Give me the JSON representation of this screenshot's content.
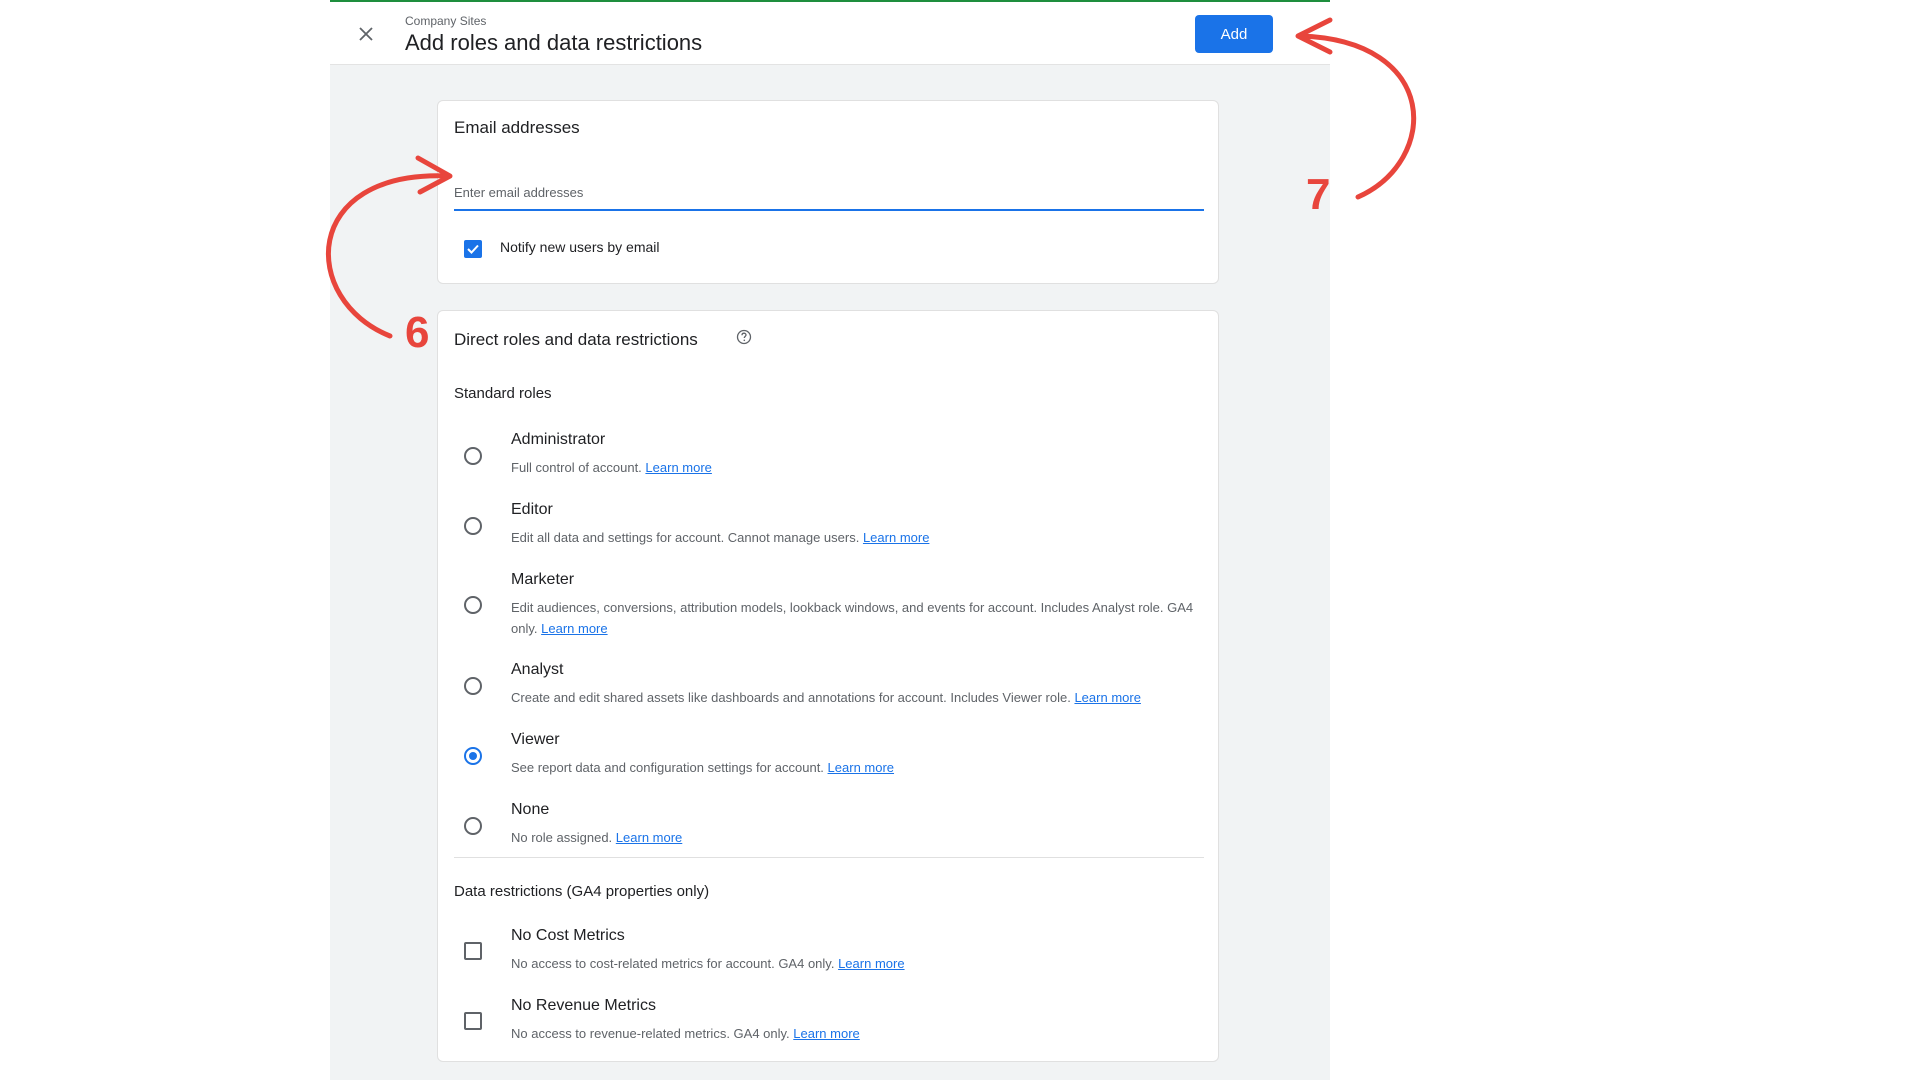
{
  "header": {
    "breadcrumb": "Company Sites",
    "title": "Add roles and data restrictions",
    "add_label": "Add"
  },
  "email_card": {
    "title": "Email addresses",
    "placeholder": "Enter email addresses",
    "value": "",
    "notify_label": "Notify new users by email",
    "notify_checked": true
  },
  "roles_card": {
    "title": "Direct roles and data restrictions",
    "standard_label": "Standard roles",
    "roles": [
      {
        "name": "Administrator",
        "desc": "Full control of account.",
        "link": "Learn more"
      },
      {
        "name": "Editor",
        "desc": "Edit all data and settings for account. Cannot manage users.",
        "link": "Learn more"
      },
      {
        "name": "Marketer",
        "desc": "Edit audiences, conversions, attribution models, lookback windows, and events for account. Includes Analyst role. GA4 only.",
        "link": "Learn more"
      },
      {
        "name": "Analyst",
        "desc": "Create and edit shared assets like dashboards and annotations for account. Includes Viewer role.",
        "link": "Learn more"
      },
      {
        "name": "Viewer",
        "desc": "See report data and configuration settings for account.",
        "link": "Learn more"
      },
      {
        "name": "None",
        "desc": "No role assigned.",
        "link": "Learn more"
      }
    ],
    "selected_role": "Viewer",
    "restrictions_label": "Data restrictions (GA4 properties only)",
    "restrictions": [
      {
        "name": "No Cost Metrics",
        "desc": "No access to cost-related metrics for account. GA4 only.",
        "link": "Learn more"
      },
      {
        "name": "No Revenue Metrics",
        "desc": "No access to revenue-related metrics. GA4 only.",
        "link": "Learn more"
      }
    ]
  },
  "annotations": {
    "step_6": "6",
    "step_7": "7",
    "color": "#e8453c"
  },
  "colors": {
    "primary": "#1a73e8",
    "page_bg": "#f1f3f4"
  }
}
